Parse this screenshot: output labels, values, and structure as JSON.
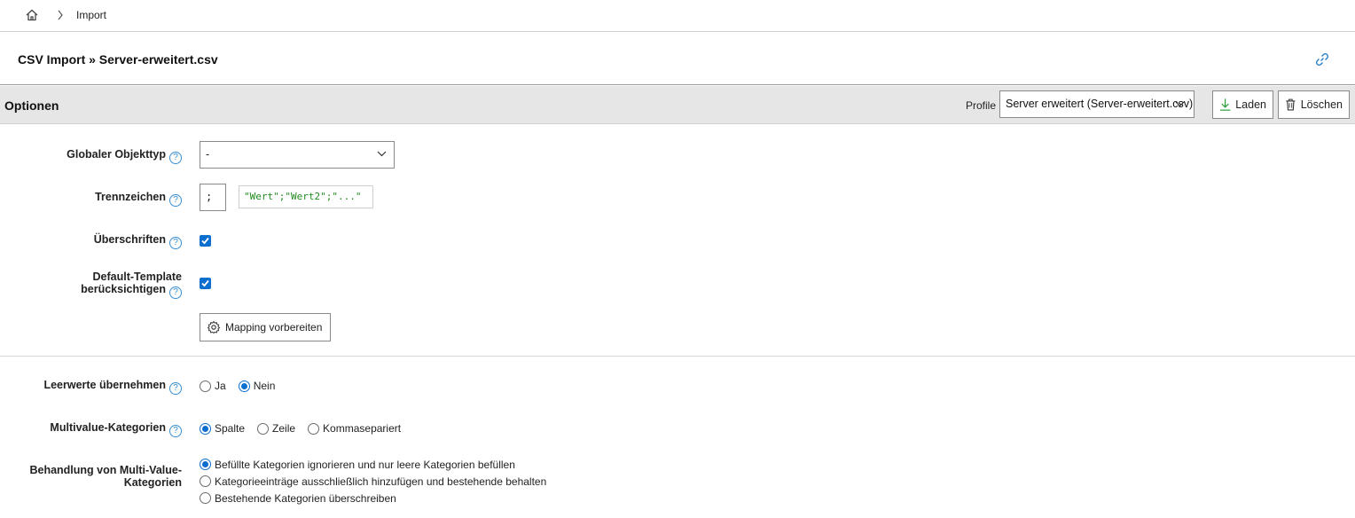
{
  "breadcrumb": {
    "home_icon": "home-icon",
    "current": "Import"
  },
  "title": {
    "text": "CSV Import » Server-erweitert.csv",
    "link_icon": "link-icon"
  },
  "options": {
    "title": "Optionen",
    "profile_label": "Profile",
    "profile_selected": "Server erweitert (Server-erweitert.csv)",
    "laden_label": "Laden",
    "loeschen_label": "Löschen"
  },
  "form": {
    "objekttyp": {
      "label": "Globaler Objekttyp",
      "value": "-"
    },
    "trennzeichen": {
      "label": "Trennzeichen",
      "value": ";",
      "example": "\"Wert\";\"Wert2\";\"...\""
    },
    "ueberschriften": {
      "label": "Überschriften",
      "checked": true
    },
    "default_template": {
      "label_line1": "Default-Template",
      "label_line2": "berücksichtigen",
      "checked": true
    },
    "mapping_button": "Mapping vorbereiten"
  },
  "leerwerte": {
    "label": "Leerwerte übernehmen",
    "options": [
      {
        "label": "Ja",
        "selected": false
      },
      {
        "label": "Nein",
        "selected": true
      }
    ]
  },
  "multivalue": {
    "label": "Multivalue-Kategorien",
    "options": [
      {
        "label": "Spalte",
        "selected": true
      },
      {
        "label": "Zeile",
        "selected": false
      },
      {
        "label": "Kommasepariert",
        "selected": false
      }
    ]
  },
  "behandlung": {
    "label_line1": "Behandlung von Multi-Value-",
    "label_line2": "Kategorien",
    "options": [
      {
        "label": "Befüllte Kategorien ignorieren und nur leere Kategorien befüllen",
        "selected": true
      },
      {
        "label": "Kategorieeinträge ausschließlich hinzufügen und bestehende behalten",
        "selected": false
      },
      {
        "label": "Bestehende Kategorien überschreiben",
        "selected": false
      }
    ]
  },
  "colors": {
    "accent": "#0b6fd0",
    "help": "#3a8fd0",
    "example_text": "#1f8a1f",
    "header_bg": "#e6e6e6"
  }
}
